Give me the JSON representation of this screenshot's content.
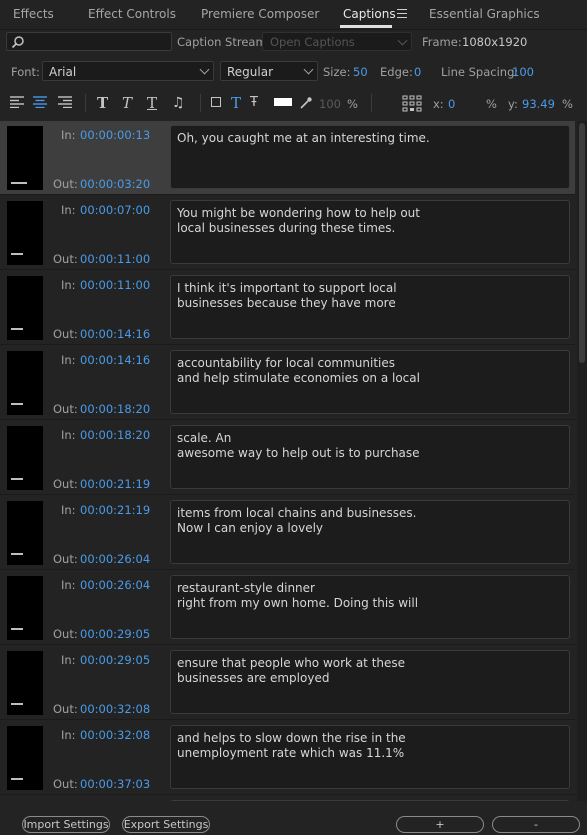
{
  "tabs": [
    {
      "label": "Effects"
    },
    {
      "label": "Effect Controls"
    },
    {
      "label": "Premiere Composer"
    },
    {
      "label": "Captions"
    },
    {
      "label": "Essential Graphics"
    }
  ],
  "toolbar1": {
    "caption_stream_label": "Caption Stream:",
    "caption_stream_value": "Open Captions",
    "frame_label": "Frame:",
    "frame_value": "1080x1920"
  },
  "toolbar2": {
    "font_label": "Font:",
    "font_value": "Arial",
    "style_value": "Regular",
    "size_label": "Size:",
    "size_value": "50",
    "edge_label": "Edge:",
    "edge_value": "0",
    "line_spacing_label": "Line Spacing:",
    "line_spacing_value": "100"
  },
  "toolbar3": {
    "opacity_value": "100",
    "opacity_unit": "%",
    "x_label": "x:",
    "x_value": "0",
    "x_unit": "%",
    "y_label": "y:",
    "y_value": "93.49",
    "y_unit": "%"
  },
  "captions": [
    {
      "in_label": "In:",
      "in": "00:00:00:13",
      "out_label": "Out:",
      "out": "00:00:03:20",
      "text": "Oh, you caught me at an interesting time."
    },
    {
      "in_label": "In:",
      "in": "00:00:07:00",
      "out_label": "Out:",
      "out": "00:00:11:00",
      "text": "You might be wondering how to help out\nlocal businesses during these times."
    },
    {
      "in_label": "In:",
      "in": "00:00:11:00",
      "out_label": "Out:",
      "out": "00:00:14:16",
      "text": "I think it's important to support local\nbusinesses because they have more"
    },
    {
      "in_label": "In:",
      "in": "00:00:14:16",
      "out_label": "Out:",
      "out": "00:00:18:20",
      "text": "accountability for local communities\nand help stimulate economies on a local"
    },
    {
      "in_label": "In:",
      "in": "00:00:18:20",
      "out_label": "Out:",
      "out": "00:00:21:19",
      "text": "scale. An\nawesome way to help out is to purchase"
    },
    {
      "in_label": "In:",
      "in": "00:00:21:19",
      "out_label": "Out:",
      "out": "00:00:26:04",
      "text": "items from local chains and businesses.\nNow I can enjoy a lovely"
    },
    {
      "in_label": "In:",
      "in": "00:00:26:04",
      "out_label": "Out:",
      "out": "00:00:29:05",
      "text": "restaurant-style dinner\nright from my own home. Doing this will"
    },
    {
      "in_label": "In:",
      "in": "00:00:29:05",
      "out_label": "Out:",
      "out": "00:00:32:08",
      "text": "ensure that people who work at these\nbusinesses are employed"
    },
    {
      "in_label": "In:",
      "in": "00:00:32:08",
      "out_label": "Out:",
      "out": "00:00:37:03",
      "text": "and helps to slow down the rise in the\nunemployment rate which was 11.1%"
    }
  ],
  "bottom": {
    "import_label": "Import Settings",
    "export_label": "Export Settings",
    "add_label": "+",
    "remove_label": "-"
  },
  "colors": {
    "accent": "#4a9be8",
    "background": "#232323",
    "selected_row": "#3e3e3e"
  }
}
